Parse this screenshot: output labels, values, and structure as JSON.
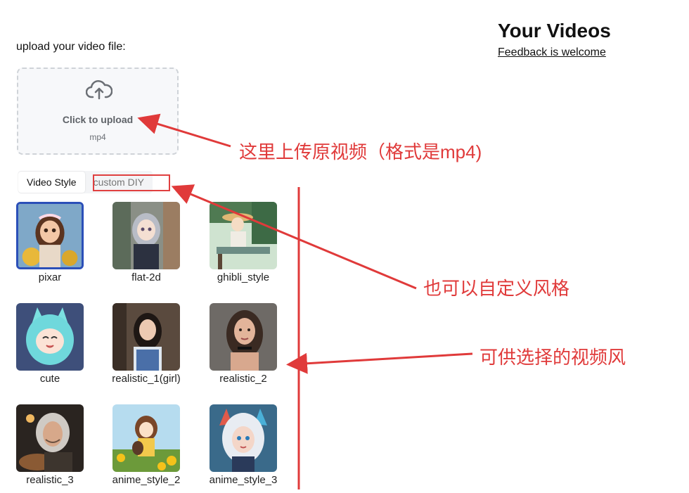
{
  "upload": {
    "label": "upload your video file:",
    "title": "Click to upload",
    "format": "mp4"
  },
  "tabs": [
    {
      "label": "Video Style"
    },
    {
      "label": "custom DIY"
    }
  ],
  "header": {
    "title": "Your Videos",
    "feedback": "Feedback is welcome"
  },
  "styles": [
    {
      "label": "pixar",
      "selected": true
    },
    {
      "label": "flat-2d"
    },
    {
      "label": "ghibli_style"
    },
    {
      "label": "cute"
    },
    {
      "label": "realistic_1(girl)"
    },
    {
      "label": "realistic_2"
    },
    {
      "label": "realistic_3"
    },
    {
      "label": "anime_style_2"
    },
    {
      "label": "anime_style_3"
    }
  ],
  "annotations": {
    "upload_note": "这里上传原视频（格式是mp4)",
    "diy_note": "也可以自定义风格",
    "styles_note": "可供选择的视频风"
  },
  "colors": {
    "annotation": "#e03a3a",
    "selected_border": "#2b4fb8"
  }
}
